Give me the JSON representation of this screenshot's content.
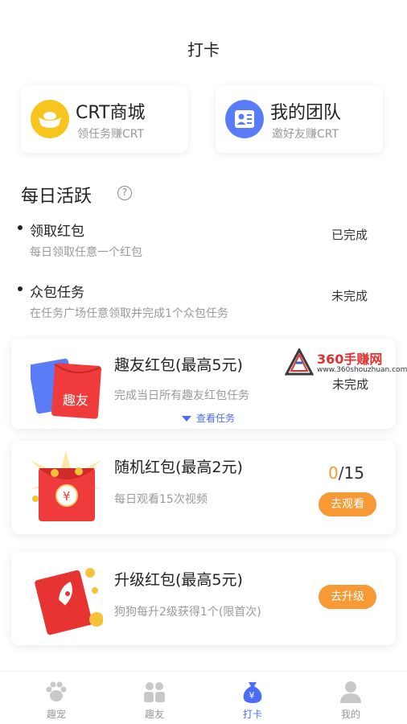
{
  "header": {
    "title": "打卡"
  },
  "quick_links": [
    {
      "title": "CRT商城",
      "subtitle": "领任务赚CRT",
      "icon": "gold-ingot-icon"
    },
    {
      "title": "我的团队",
      "subtitle": "邀好友赚CRT",
      "icon": "contact-card-icon"
    }
  ],
  "daily": {
    "title": "每日活跃",
    "help_icon": "?",
    "tasks": [
      {
        "name": "领取红包",
        "desc": "每日领取任意一个红包",
        "status": "已完成"
      },
      {
        "name": "众包任务",
        "desc": "在任务广场任意领取并完成1个众包任务",
        "status": "未完成"
      }
    ]
  },
  "red_packets": [
    {
      "title": "趣友红包(最高5元)",
      "desc": "完成当日所有趣友红包任务",
      "status": "未完成",
      "link": "查看任务",
      "image_text": "趣友"
    },
    {
      "title": "随机红包(最高2元)",
      "desc": "每日观看15次视频",
      "progress_current": "0",
      "progress_total": "/15",
      "button": "去观看",
      "image_text": "¥"
    },
    {
      "title": "升级红包(最高5元)",
      "desc": "狗狗每升2级获得1个(限首次)",
      "button": "去升级"
    }
  ],
  "watermark": {
    "main": "360手赚网",
    "url": "www.360shouzhuan.com"
  },
  "tabs": [
    {
      "label": "趣宠",
      "icon": "paw-icon",
      "active": false
    },
    {
      "label": "趣友",
      "icon": "friends-icon",
      "active": false
    },
    {
      "label": "打卡",
      "icon": "money-bag-icon",
      "active": true
    },
    {
      "label": "我的",
      "icon": "user-icon",
      "active": false
    }
  ],
  "colors": {
    "accent": "#f79a35",
    "active_tab": "#4a6cf7",
    "gold": "#f6b51c",
    "blue": "#5a7cf6",
    "red": "#ef3b3b"
  }
}
